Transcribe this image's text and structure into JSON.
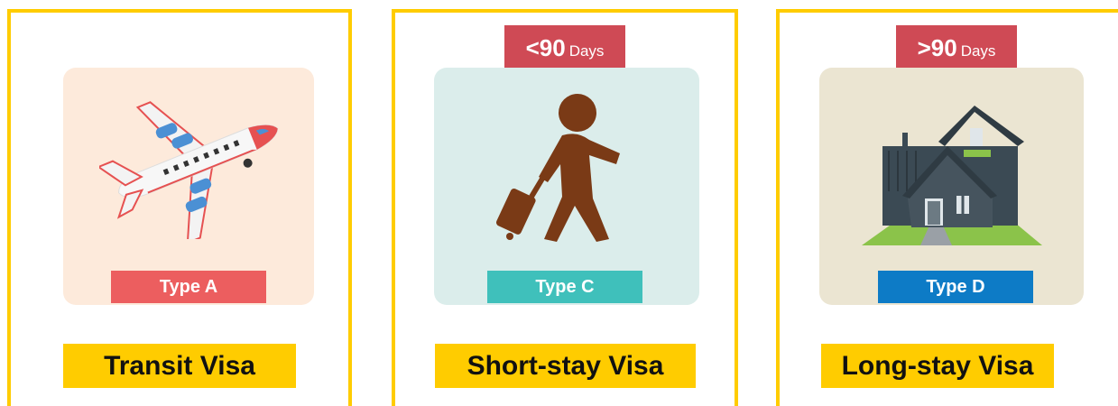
{
  "cards": {
    "a": {
      "type_label": "Type A",
      "title": "Transit Visa",
      "type_color": "#ec5e5f",
      "panel_color": "#fdeadb",
      "icon": "airplane-icon"
    },
    "c": {
      "days_num": "<90",
      "days_unit": "Days",
      "type_label": "Type C",
      "title": "Short-stay Visa",
      "type_color": "#3fc0bb",
      "panel_color": "#dbedeb",
      "icon": "traveler-icon"
    },
    "d": {
      "days_num": ">90",
      "days_unit": "Days",
      "type_label": "Type D",
      "title": "Long-stay Visa",
      "type_color": "#0d7bc6",
      "panel_color": "#ebe5d2",
      "icon": "house-icon"
    }
  },
  "colors": {
    "border": "#ffcc00",
    "days_badge": "#cf4a55",
    "title_bar": "#ffcc00"
  }
}
